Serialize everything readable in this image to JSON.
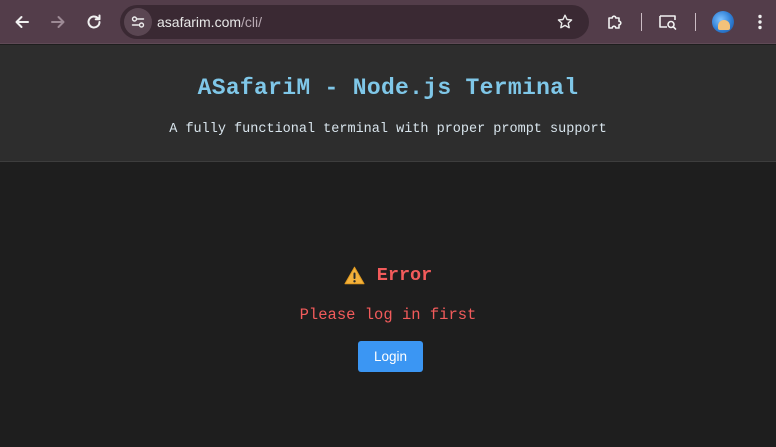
{
  "browser": {
    "url_domain": "asafarim.com",
    "url_path": "/cli/",
    "toolbar_color": "#533d4a"
  },
  "icons": {
    "back": "back-arrow-icon",
    "forward": "forward-arrow-icon",
    "reload": "reload-icon",
    "site_settings": "tune-icon",
    "bookmark": "star-icon",
    "extensions": "puzzle-icon",
    "tab_search": "tab-search-icon",
    "profile": "avatar",
    "menu": "kebab-menu-icon",
    "error": "warning-icon"
  },
  "header": {
    "title": "ASafariM - Node.js Terminal",
    "subtitle": "A fully functional terminal with proper prompt support"
  },
  "main": {
    "error_title": "Error",
    "error_message": "Please log in first",
    "login_label": "Login"
  },
  "colors": {
    "title": "#7fc7e8",
    "error": "#f25b5b",
    "button": "#3b96f3",
    "background": "#1e1e1e",
    "header_background": "#2d2d2d"
  }
}
